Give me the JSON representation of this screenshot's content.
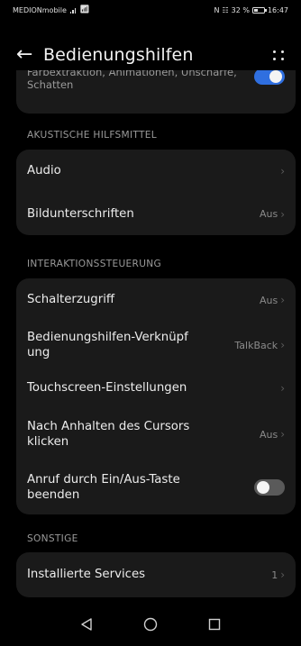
{
  "status": {
    "carrier": "MEDIONmobile",
    "battery": "32 %",
    "time": "16:47"
  },
  "header": {
    "title": "Bedienungshilfen"
  },
  "top_card": {
    "line1": "Farbextraktion, Animationen, Unschärfe,",
    "line2": "Schatten"
  },
  "sections": {
    "audio_label": "AKUSTISCHE HILFSMITTEL",
    "interaction_label": "INTERAKTIONSSTEUERUNG",
    "other_label": "SONSTIGE"
  },
  "audio": {
    "audio": "Audio",
    "captions": "Bildunterschriften",
    "captions_value": "Aus"
  },
  "interaction": {
    "switch_access": "Schalterzugriff",
    "switch_access_value": "Aus",
    "shortcut_line1": "Bedienungshilfen-Verknüpf",
    "shortcut_line2": "ung",
    "shortcut_value": "TalkBack",
    "touchscreen": "Touchscreen-Einstellungen",
    "dwell_line1": "Nach Anhalten des Cursors",
    "dwell_line2": "klicken",
    "dwell_value": "Aus",
    "power_end_line1": "Anruf durch Ein/Aus-Taste",
    "power_end_line2": "beenden",
    "power_end_on": false
  },
  "other": {
    "installed": "Installierte Services",
    "installed_value": "1"
  },
  "colors": {
    "accent": "#2f6fe0",
    "card": "#1a1a1a",
    "background": "#000000"
  }
}
